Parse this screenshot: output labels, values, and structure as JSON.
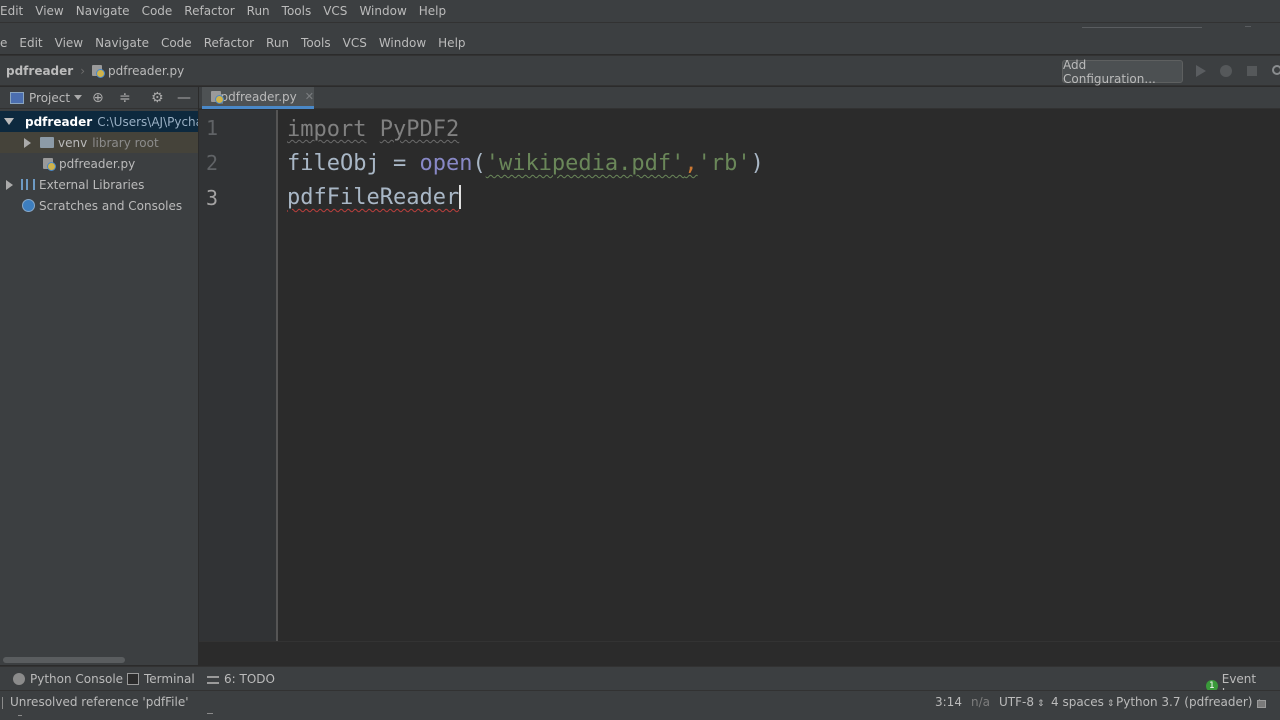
{
  "menu_top": [
    "Edit",
    "View",
    "Navigate",
    "Code",
    "Refactor",
    "Run",
    "Tools",
    "VCS",
    "Window",
    "Help"
  ],
  "menu_second": [
    "e",
    "Edit",
    "View",
    "Navigate",
    "Code",
    "Refactor",
    "Run",
    "Tools",
    "VCS",
    "Window",
    "Help"
  ],
  "navbar": {
    "project": "pdfreader",
    "file": "pdfreader.py",
    "add_config": "Add Configuration..."
  },
  "sidebar": {
    "header": "Project",
    "root_name": "pdfreader",
    "root_path": "C:\\Users\\AJ\\Pycha",
    "venv_name": "venv",
    "venv_note": "library root",
    "file": "pdfreader.py",
    "external": "External Libraries",
    "scratches": "Scratches and Consoles"
  },
  "editor": {
    "tab": "pdfreader.py",
    "line_numbers": [
      "1",
      "2",
      "3"
    ],
    "line1": {
      "kw": "import",
      "space": " ",
      "mod": "PyPDF2"
    },
    "line2": {
      "var": "fileObj",
      "eq": " = ",
      "fn": "open",
      "lp": "(",
      "s1": "'wikipedia.pdf'",
      "comma": ",",
      "s2": "'rb'",
      "rp": ")"
    },
    "line3": {
      "text": "pdfFileReader"
    }
  },
  "toolwindows": {
    "python_console": "Python Console",
    "terminal": "Terminal",
    "todo": "6: TODO",
    "event_log": "Event Log",
    "event_count": "1"
  },
  "status": {
    "message": "Unresolved reference 'pdfFile'",
    "position": "3:14",
    "na": "n/a",
    "encoding": "UTF-8",
    "indent": "4 spaces",
    "interpreter": "Python 3.7 (pdfreader)",
    "updown": "⇕"
  }
}
